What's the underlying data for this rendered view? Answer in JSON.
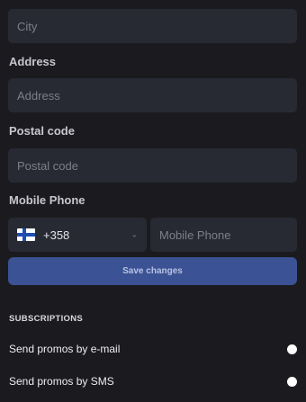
{
  "form": {
    "city": {
      "placeholder": "City"
    },
    "address": {
      "label": "Address",
      "placeholder": "Address"
    },
    "postal_code": {
      "label": "Postal code",
      "placeholder": "Postal code"
    },
    "mobile_phone": {
      "label": "Mobile Phone",
      "country": {
        "flag": "finland-flag-icon",
        "dial_code": "+358"
      },
      "placeholder": "Mobile Phone"
    },
    "save_label": "Save changes"
  },
  "subscriptions": {
    "title": "SUBSCRIPTIONS",
    "items": [
      {
        "label": "Send promos by e-mail",
        "enabled": false
      },
      {
        "label": "Send promos by SMS",
        "enabled": false
      }
    ]
  },
  "colors": {
    "background": "#1b1b1f",
    "field": "#272a33",
    "accent_button": "#3b5294"
  }
}
